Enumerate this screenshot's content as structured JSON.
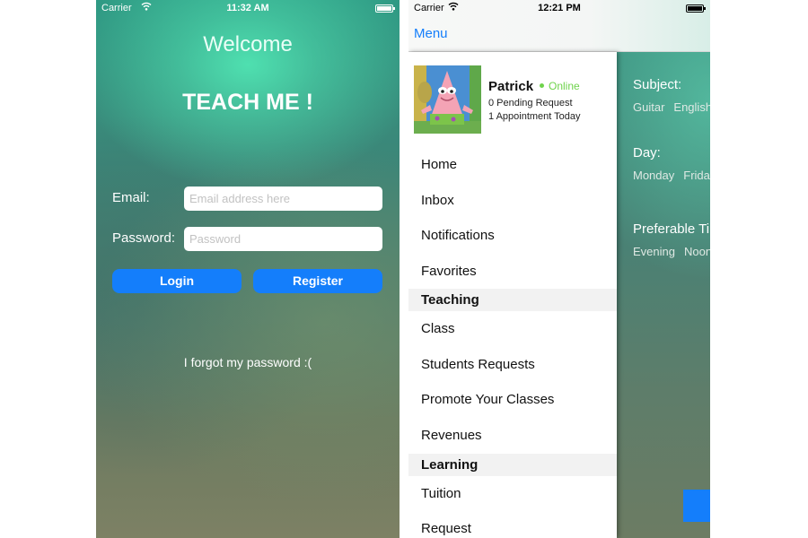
{
  "login_screen": {
    "status_bar": {
      "carrier": "Carrier",
      "time": "11:32 AM"
    },
    "welcome": "Welcome",
    "app_title": "TEACH ME !",
    "email_label": "Email:",
    "email_placeholder": "Email address here",
    "password_label": "Password:",
    "password_placeholder": "Password",
    "login_button": "Login",
    "register_button": "Register",
    "forgot_link": "I forgot my password :("
  },
  "menu_screen": {
    "status_bar": {
      "carrier": "Carrier",
      "time": "12:21 PM"
    },
    "nav": {
      "menu_button": "Menu"
    },
    "profile": {
      "name": "Patrick",
      "status": "Online",
      "pending": "0 Pending Request",
      "appointments": "1 Appointment Today"
    },
    "menu_items": [
      {
        "label": "Home"
      },
      {
        "label": "Inbox"
      },
      {
        "label": "Notifications"
      },
      {
        "label": "Favorites"
      }
    ],
    "section_teaching": "Teaching",
    "teaching_items": [
      {
        "label": "Class"
      },
      {
        "label": "Students Requests"
      },
      {
        "label": "Promote Your Classes"
      },
      {
        "label": "Revenues"
      }
    ],
    "section_learning": "Learning",
    "learning_items": [
      {
        "label": "Tuition"
      },
      {
        "label": "Request"
      }
    ],
    "background": {
      "subject_label": "Subject:",
      "subjects": [
        "Guitar",
        "English"
      ],
      "day_label": "Day:",
      "days": [
        "Monday",
        "Friday"
      ],
      "preferable_time_label": "Preferable Time:",
      "times": [
        "Evening",
        "Noon"
      ]
    }
  },
  "colors": {
    "accent_blue": "#147efb",
    "online_green": "#6fd34c",
    "teal": "#4fe0b0"
  }
}
